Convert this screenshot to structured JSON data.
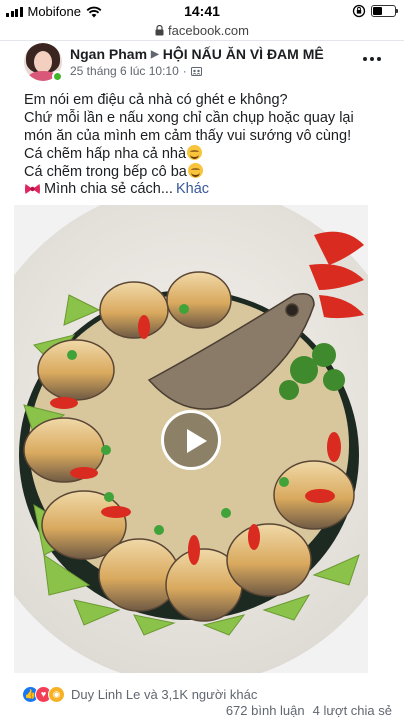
{
  "status_bar": {
    "carrier": "Mobifone",
    "time": "14:41",
    "signal_bars": 4,
    "battery_level": 0.45
  },
  "browser": {
    "url": "facebook.com"
  },
  "post": {
    "author": "Ngan Pham",
    "group": "HỘI NẤU ĂN VÌ ĐAM MÊ",
    "timestamp": "25 tháng 6 lúc 10:10",
    "privacy_icon": "group-privacy-icon",
    "text_lines": [
      "Em nói em điệu cả nhà có ghét e không?",
      "Chứ mỗi lần e nấu xong chỉ cần chụp hoặc quay lại",
      "món ăn của mình em cảm thấy vui sướng vô cùng!",
      "Cá chẽm hấp nha cả nhà",
      "Cá chẽm trong bếp cô ba"
    ],
    "share_text": "Mình chia sẻ cách...",
    "more_link": "Khác"
  },
  "media": {
    "type": "video",
    "play_icon": "play-icon"
  },
  "footer": {
    "reactions": [
      "like",
      "love",
      "wow"
    ],
    "reaction_summary": "Duy Linh Le và 3,1K người khác",
    "comments": "672 bình luận",
    "shares": "4 lượt chia sẻ"
  },
  "colors": {
    "link": "#385898",
    "online": "#42b72a",
    "like": "#1877f2",
    "love": "#f33e58",
    "wow": "#f7b125"
  }
}
